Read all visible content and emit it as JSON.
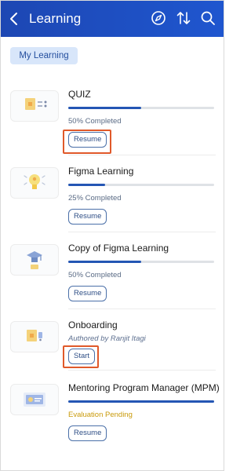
{
  "header": {
    "title": "Learning"
  },
  "filter": {
    "chip_label": "My Learning"
  },
  "courses": [
    {
      "title": "QUIZ",
      "status": "50% Completed",
      "progress": 0.5,
      "button": "Resume"
    },
    {
      "title": "Figma Learning",
      "status": "25% Completed",
      "progress": 0.25,
      "button": "Resume"
    },
    {
      "title": "Copy of Figma Learning",
      "status": "50% Completed",
      "progress": 0.5,
      "button": "Resume"
    },
    {
      "title": "Onboarding",
      "status": "Authored by Ranjit Itagi",
      "button": "Start"
    },
    {
      "title": "Mentoring Program Manager (MPM)",
      "status": "Evaluation Pending",
      "progress": 1.0,
      "button": "Resume"
    }
  ],
  "colors": {
    "header": "#1f4fc4",
    "progress": "#2456b4",
    "pending": "#c99a0a",
    "highlight": "#e0592a"
  }
}
